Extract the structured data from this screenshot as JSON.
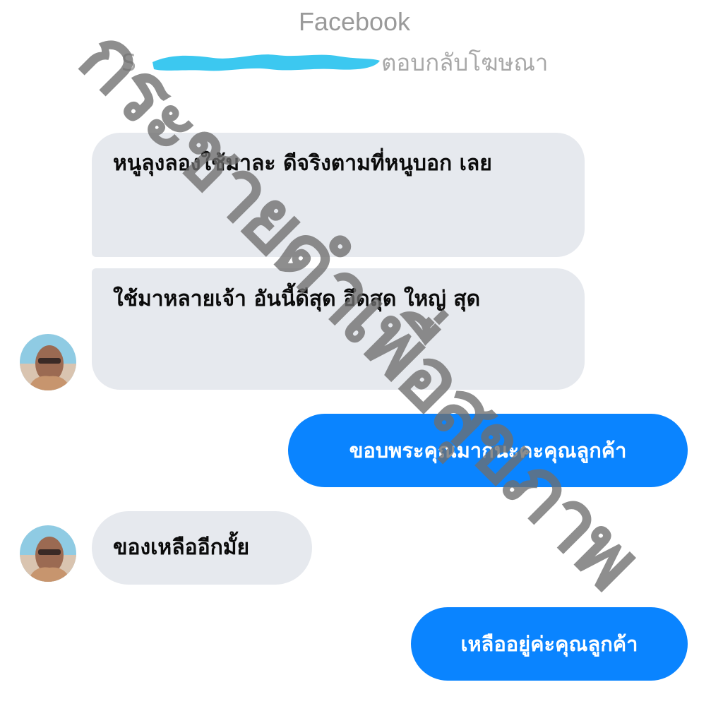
{
  "header": {
    "title": "Facebook",
    "subtitle_prefix": "S",
    "subtitle_suffix": "ตอบกลับโฆษณา"
  },
  "messages": [
    {
      "direction": "incoming",
      "text": "หนูลุงลองใช้มาละ ดีจริงตามที่หนูบอก เลย"
    },
    {
      "direction": "incoming",
      "text": "ใช้มาหลายเจ้า อันนี้ดีสุด อึดสุด ใหญ่ สุด"
    },
    {
      "direction": "outgoing",
      "text": "ขอบพระคุณมากนะคะคุณลูกค้า"
    },
    {
      "direction": "incoming",
      "text": "ของเหลืออีกมั้ย"
    },
    {
      "direction": "outgoing",
      "text": "เหลืออยู่ค่ะคุณลูกค้า"
    }
  ],
  "watermark": "กระชายดำเพื่อสุขภาพ",
  "colors": {
    "outgoing_bubble": "#0a84ff",
    "incoming_bubble": "#e6e9ee",
    "redaction": "#3cc8f0",
    "header_text": "#9a9a9a"
  },
  "icons": {
    "avatar": "user-avatar-photo"
  }
}
